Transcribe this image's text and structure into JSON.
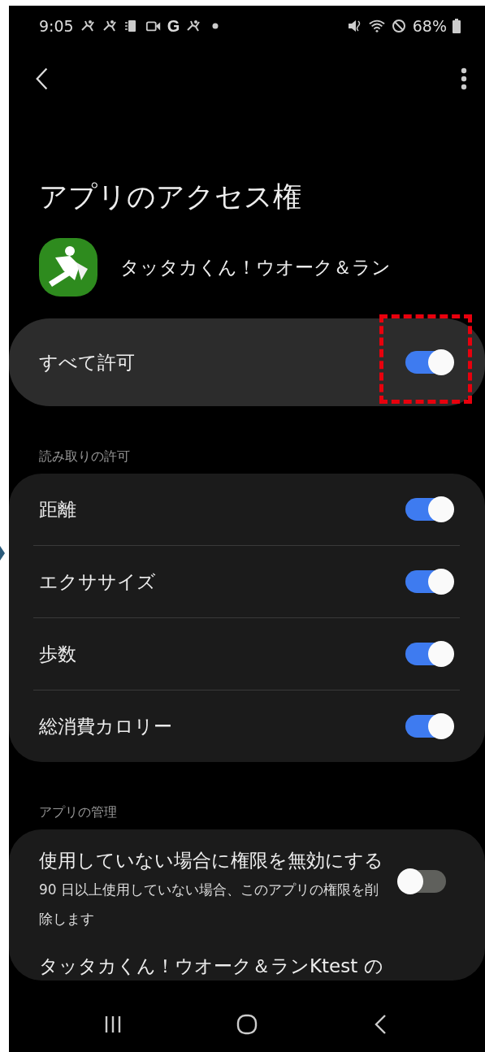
{
  "status_bar": {
    "time": "9:05",
    "letter_icon": "G",
    "battery": "68%"
  },
  "title": "アプリのアクセス権",
  "app": {
    "name": "タッタカくん！ウオーク＆ラン"
  },
  "allow_all": {
    "label": "すべて許可",
    "on": true,
    "highlighted": true
  },
  "read_section": {
    "header": "読み取りの許可",
    "items": [
      {
        "label": "距離",
        "on": true
      },
      {
        "label": "エクササイズ",
        "on": true
      },
      {
        "label": "歩数",
        "on": true
      },
      {
        "label": "総消費カロリー",
        "on": true
      }
    ]
  },
  "manage_section": {
    "header": "アプリの管理",
    "items": [
      {
        "label": "使用していない場合に権限を無効にする",
        "description": "90 日以上使用していない場合、このアプリの権限を削除します",
        "on": false
      },
      {
        "label": "タッタカくん！ウオーク＆ランKtest の"
      }
    ]
  }
}
